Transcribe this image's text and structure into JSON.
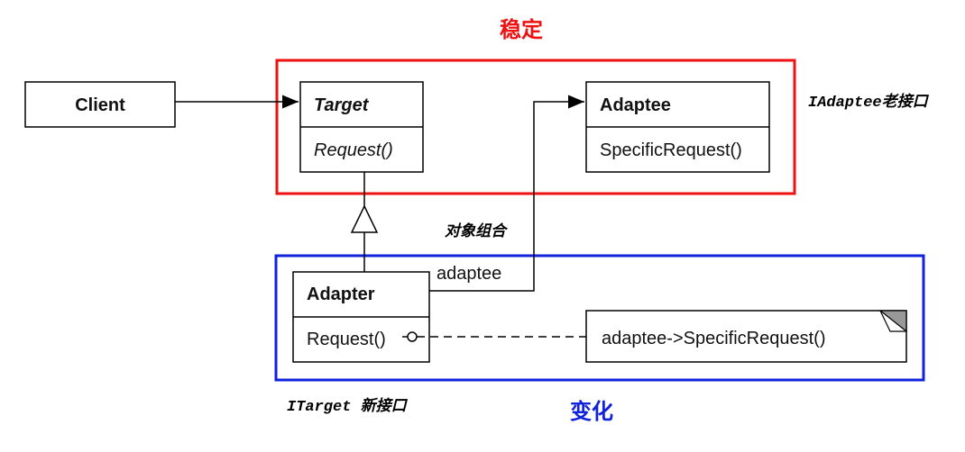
{
  "labels": {
    "stable": "稳定",
    "variable": "变化",
    "adaptee_interface_note": "IAdaptee老接口",
    "target_interface_note": "ITarget 新接口",
    "composition_note": "对象组合",
    "association_role": "adaptee"
  },
  "classes": {
    "client": {
      "name": "Client"
    },
    "target": {
      "name": "Target",
      "operation": "Request()"
    },
    "adaptee": {
      "name": "Adaptee",
      "operation": "SpecificRequest()"
    },
    "adapter": {
      "name": "Adapter",
      "operation": "Request()"
    }
  },
  "code_note": {
    "text": "adaptee->SpecificRequest()"
  },
  "colors": {
    "stable_box": "#ee1111",
    "variable_box": "#1122dd",
    "stable_label": "#ee1111",
    "variable_label": "#1122dd",
    "note_corner": "#999999"
  }
}
